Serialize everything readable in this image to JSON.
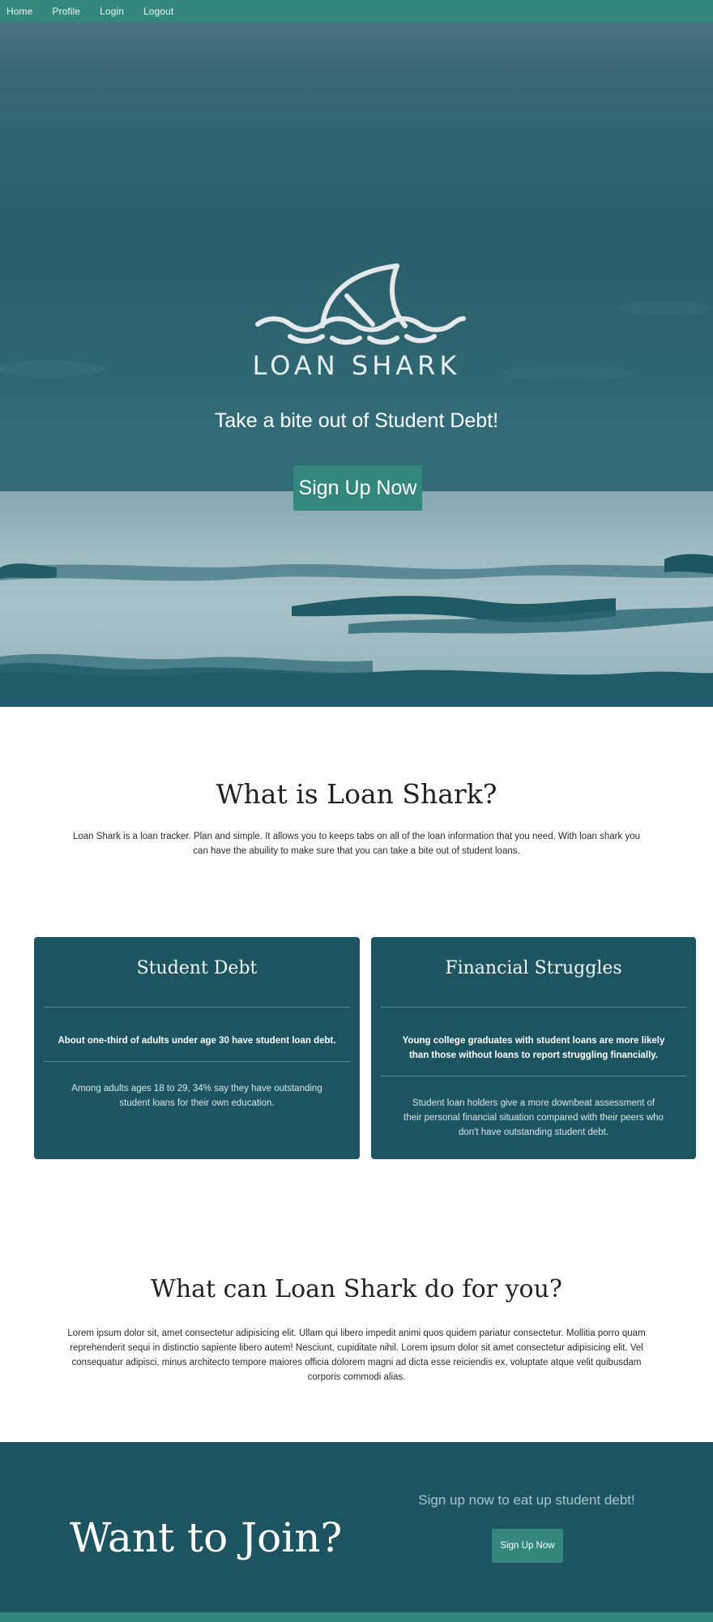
{
  "nav": {
    "items": [
      {
        "label": "Home"
      },
      {
        "label": "Profile"
      },
      {
        "label": "Login"
      },
      {
        "label": "Logout"
      }
    ]
  },
  "hero": {
    "brand": "LOAN SHARK",
    "tagline": "Take a bite out of Student Debt!",
    "cta_label": "Sign Up Now"
  },
  "about": {
    "title": "What is Loan Shark?",
    "text": "Loan Shark is a loan tracker. Plan and simple. It allows you to keeps tabs on all of the loan information that you need. With loan shark you can have the abuility to make sure that you can take a bite out of student loans."
  },
  "cards": [
    {
      "title": "Student Debt",
      "highlight": "About one-third of adults under age 30 have student loan debt.",
      "body": "Among adults ages 18 to 29, 34% say they have outstanding student loans for their own education."
    },
    {
      "title": "Financial Struggles",
      "highlight": "Young college graduates with student loans are more likely than those without loans to report struggling financially.",
      "body": "Student loan holders give a more downbeat assessment of their personal financial situation compared with their peers who don't have outstanding student debt."
    }
  ],
  "what": {
    "title": "What can Loan Shark do for you?",
    "text": "Lorem ipsum dolor sit, amet consectetur adipisicing elit. Ullam qui libero impedit animi quos quidem pariatur consectetur. Mollitia porro quam reprehenderit sequi in distinctio sapiente libero autem! Nesciunt, cupiditate nihil. Lorem ipsum dolor sit amet consectetur adipisicing elit. Vel consequatur adipisci, minus architecto tempore maiores officia dolorem magni ad dicta esse reiciendis ex, voluptate atque velit quibusdam corporis commodi alias."
  },
  "join": {
    "title": "Want to Join?",
    "subtitle": "Sign up now to eat up student debt!",
    "button_label": "Sign Up Now"
  },
  "colors": {
    "nav": "#33877b",
    "dark_teal": "#1c5561",
    "button": "#33877b"
  }
}
